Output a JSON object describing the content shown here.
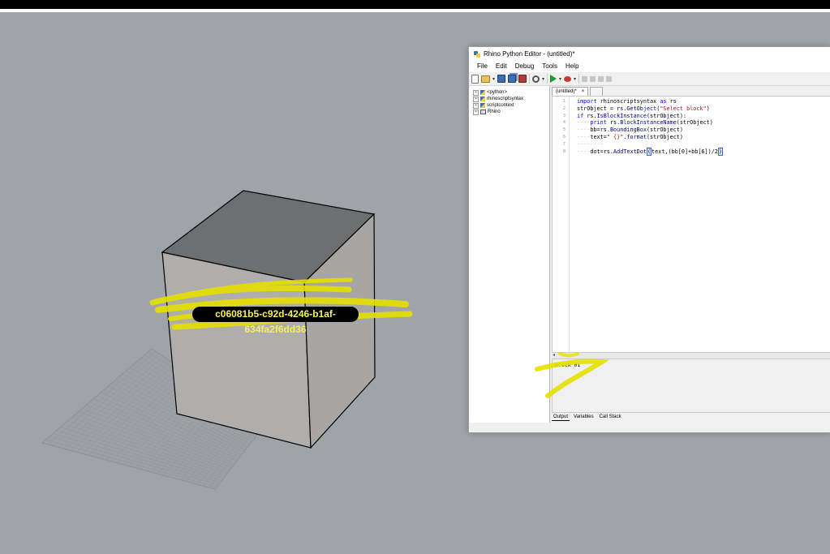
{
  "viewport": {
    "text_dot": "c06081b5-c92d-4246-b1af-634fa2f6dd36"
  },
  "editor": {
    "title": "Rhino Python Editor - (untitled)*",
    "menu": [
      "File",
      "Edit",
      "Debug",
      "Tools",
      "Help"
    ],
    "tree": [
      "<python>",
      "rhinoscriptsyntax",
      "scriptcontext",
      "Rhino"
    ],
    "tab_label": "(untitled)*",
    "tab_close": "×",
    "line_numbers": [
      "1",
      "2",
      "3",
      "4",
      "5",
      "6",
      "7",
      "8"
    ],
    "code": {
      "l1_kw1": "import",
      "l1_mod": " rhinoscriptsyntax ",
      "l1_kw2": "as",
      "l1_alias": " rs",
      "l2_a": "strObject = rs.",
      "l2_fn": "GetObject",
      "l2_b": "(",
      "l2_str": "\"Select block\"",
      "l2_c": ")",
      "l3_kw": "if",
      "l3_a": " rs.",
      "l3_fn": "IsBlockInstance",
      "l3_b": "(strObject):",
      "l4_dots": "····",
      "l4_kw": "print",
      "l4_a": " rs.",
      "l4_fn": "BlockInstanceName",
      "l4_b": "(strObject)",
      "l5_dots": "····",
      "l5_a": "bb=rs.",
      "l5_fn": "BoundingBox",
      "l5_b": "(strObject)",
      "l6_dots": "····",
      "l6_a": "text=",
      "l6_str": "\" {}\"",
      "l6_fn": ".format",
      "l6_b": "(strObject)",
      "l7_dots": "········",
      "l8_dots": "····",
      "l8_a": "dot=rs.",
      "l8_fn": "AddTextDot",
      "l8_cursor": "(",
      "l8_b": "text,(bb[0]+bb[6])/2",
      "l8_end": ")"
    },
    "output_text": "Block 01",
    "output_tabs": [
      "Output",
      "Variables",
      "Call Stack"
    ]
  }
}
